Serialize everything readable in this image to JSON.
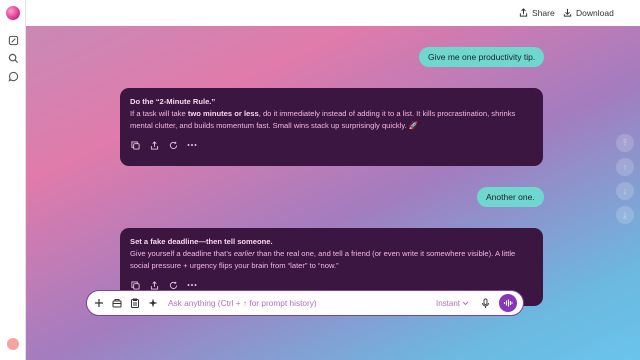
{
  "header": {
    "share_label": "Share",
    "download_label": "Download"
  },
  "conversation": {
    "user_msg_1": "Give me one productivity tip.",
    "ai_1": {
      "title": "Do the “2-Minute Rule.”",
      "text_a": "If a task will take ",
      "bold": "two minutes or less",
      "text_b": ", do it immediately instead of adding it to a list. It kills procrastination, shrinks mental clutter, and builds momentum fast. Small wins stack up surprisingly quickly. 🚀"
    },
    "user_msg_2": "Another one.",
    "ai_2": {
      "title": "Set a fake deadline—then tell someone.",
      "text_a": "Give yourself a deadline that’s ",
      "italic": "earlier",
      "text_b": " than the real one, and tell a friend (or even write it somewhere visible). A little social pressure + urgency flips your brain from “later” to “now.”"
    }
  },
  "composer": {
    "placeholder": "Ask anything (Ctrl + ↑ for prompt history)",
    "mode": "Instant"
  },
  "icons": [
    "logo-icon",
    "new-chat-icon",
    "search-icon",
    "chat-icon",
    "share-icon",
    "download-icon",
    "copy-icon",
    "export-icon",
    "regenerate-icon",
    "more-icon",
    "plus-icon",
    "attach-icon",
    "clipboard-icon",
    "sparkle-icon",
    "mic-icon",
    "voice-icon"
  ]
}
